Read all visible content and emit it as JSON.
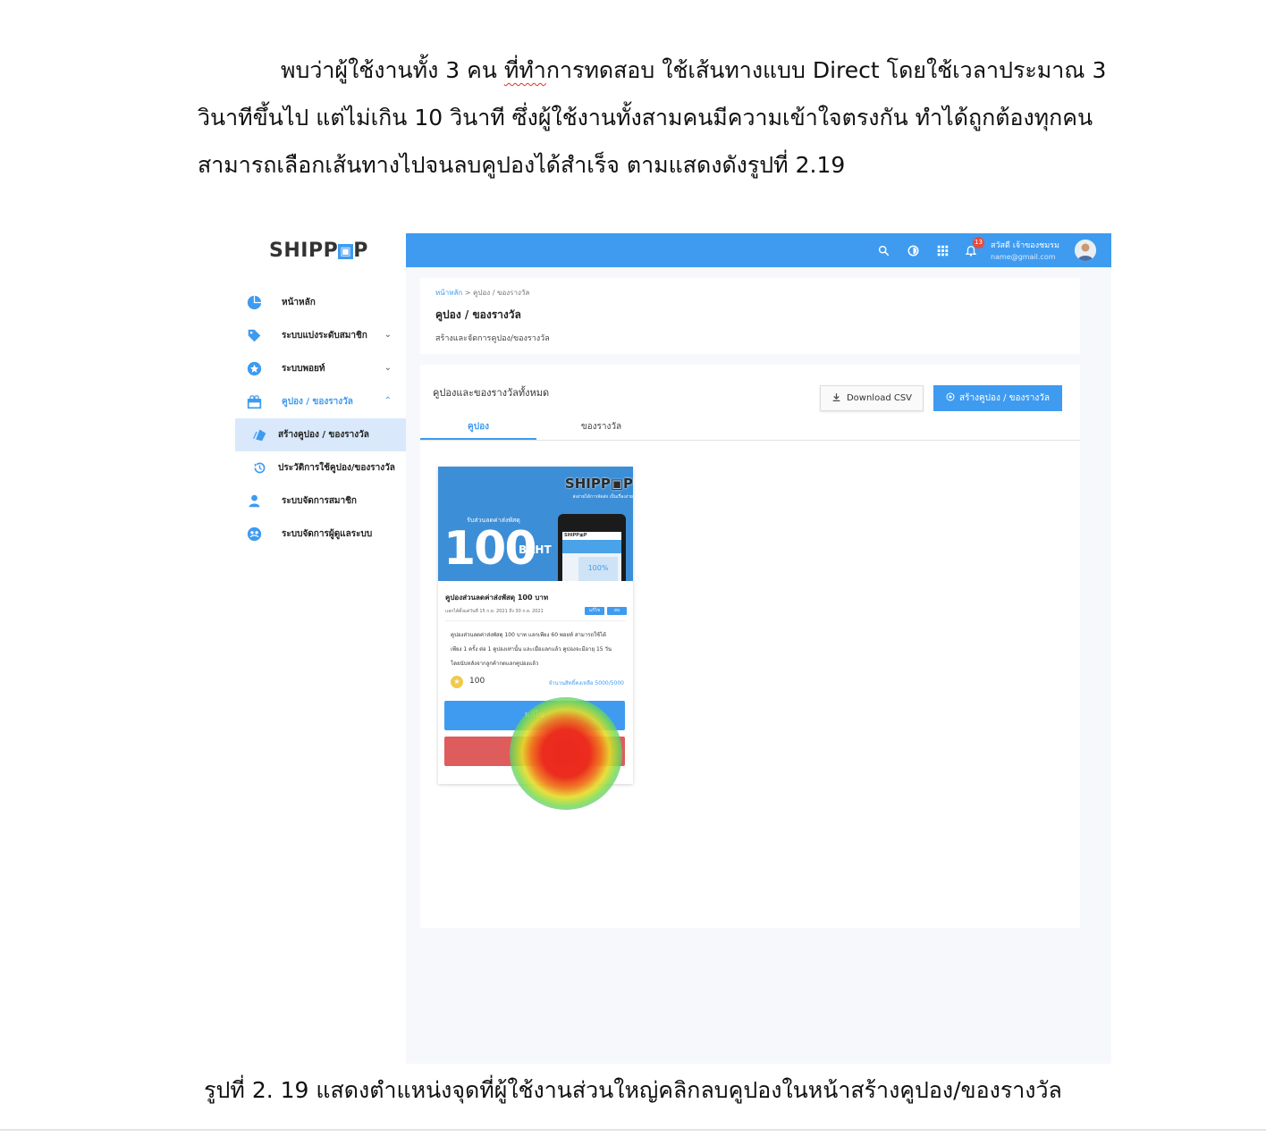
{
  "document": {
    "paragraph_line1_a": "พบว่าผู้ใช้งานทั้ง 3 คน ",
    "paragraph_line1_b": "ที่ทำ",
    "paragraph_line1_c": "การทดสอบ ใช้เส้นทางแบบ Direct โดยใช้เวลาประมาณ 3",
    "paragraph_line2": "วินาทีขึ้นไป แต่ไม่เกิน 10 วินาที ซึ่งผู้ใช้งานทั้งสามคนมีความเข้าใจตรงกัน ทำได้ถูกต้องทุกคน",
    "paragraph_line3": "สามารถเลือกเส้นทางไปจนลบคูปองได้สำเร็จ ตามแสดงดังรูปที่ 2.19",
    "caption": "รูปที่ 2. 19 แสดงตำแหน่งจุดที่ผู้ใช้งานส่วนใหญ่คลิกลบคูปองในหน้าสร้างคูปอง/ของรางวัล"
  },
  "app": {
    "logo_text_a": "SHIPP",
    "logo_text_b": "P",
    "sidebar": {
      "items": [
        {
          "label": "หน้าหลัก",
          "icon": "pie-chart-icon"
        },
        {
          "label": "ระบบแบ่งระดับสมาชิก",
          "icon": "tag-heart-icon"
        },
        {
          "label": "ระบบพอยท์",
          "icon": "star-circle-icon"
        },
        {
          "label": "คูปอง / ของรางวัล",
          "icon": "gift-icon"
        },
        {
          "label": "สร้างคูปอง / ของรางวัล",
          "icon": "ticket-icon"
        },
        {
          "label": "ประวัติการใช้คูปอง/ของรางวัล",
          "icon": "history-icon"
        },
        {
          "label": "ระบบจัดการสมาชิก",
          "icon": "person-icon"
        },
        {
          "label": "ระบบจัดการผู้ดูแลระบบ",
          "icon": "admin-icon"
        }
      ]
    },
    "topbar": {
      "notification_count": "13",
      "user_name": "สวัสดี เจ้าของชมรม",
      "user_email": "name@gmail.com"
    },
    "header": {
      "breadcrumb_home": "หน้าหลัก",
      "breadcrumb_rest": " > คูปอง / ของรางวัล",
      "title": "คูปอง / ของรางวัล",
      "subtitle": "สร้างและจัดการคูปอง/ของรางวัล"
    },
    "list": {
      "title": "คูปองและของรางวัลทั้งหมด",
      "download_label": "Download CSV",
      "create_label": "สร้างคูปอง / ของรางวัล",
      "tabs": [
        "คูปอง",
        "ของรางวัล"
      ]
    },
    "coupon": {
      "banner_logo": "SHIPP▣P",
      "banner_tagline": "ส่งง่ายได้การจัดส่ง เป็นเรื่องง่าย",
      "banner_small": "รับส่วนลดค่าส่งพัสดุ",
      "banner_amount": "100",
      "banner_currency": "BAHT",
      "phone_brand": "SHIPP▣P",
      "phone_percent": "100%",
      "title": "คูปองส่วนลดค่าส่งพัสดุ 100 บาท",
      "date_range": "แลกได้ตั้งแต่วันที่ 15 ก.ย. 2021 ถึง 30 ก.ย. 2021",
      "chip1": "แก้ไข",
      "chip2": "ลบ",
      "desc_line1": "คูปองส่วนลดค่าส่งพัสดุ 100 บาท แลกเพียง 60 พอยท์ สามารถใช้ได้",
      "desc_line2": "เพียง 1 ครั้ง ต่อ 1 คูปองเท่านั้น และเมื่อแลกแล้ว คูปองจะมีอายุ 15 วัน",
      "desc_line3": "โดยนับหลังจากลูกค้ากดแลกคูปองแล้ว",
      "points": "100",
      "remaining": "จำนวนสิทธิ์คงเหลือ 5000/5000",
      "edit_label": "แก้ไข"
    }
  },
  "colors": {
    "accent": "#3e9bf0",
    "danger": "#de5c5c",
    "page_bg": "#f6f8fc"
  }
}
